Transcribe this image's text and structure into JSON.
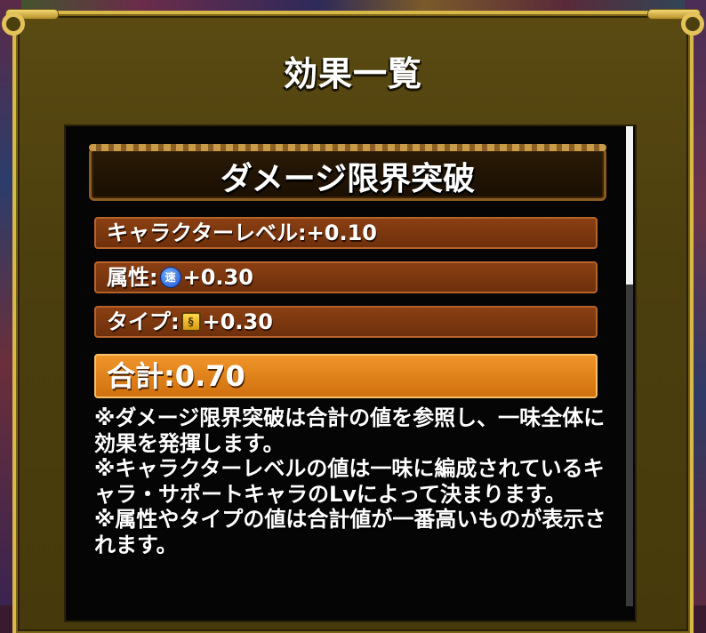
{
  "dialog": {
    "title": "効果一覧"
  },
  "section": {
    "title": "ダメージ限界突破"
  },
  "rows": {
    "character_level": "キャラクターレベル:+0.10",
    "attribute_label": "属性:",
    "attribute_icon": "speed-attribute-icon",
    "attribute_icon_glyph": "速",
    "attribute_value": "+0.30",
    "type_label": "タイプ:",
    "type_icon": "type-icon",
    "type_icon_glyph": "§",
    "type_value": "+0.30",
    "total": "合計:0.70"
  },
  "notes": [
    "※ダメージ限界突破は合計の値を参照し、一味全体に効果を発揮します。",
    "※キャラクターレベルの値は一味に編成されているキャラ・サポートキャラのLvによって決まります。",
    "※属性やタイプの値は合計値が一番高いものが表示されます。"
  ],
  "colors": {
    "panel_border": "#d9b84a",
    "panel_bg": "#4c3f0e",
    "row_bg": "#7a3610",
    "total_bg": "#e0801a",
    "inner_bg": "#050505"
  }
}
